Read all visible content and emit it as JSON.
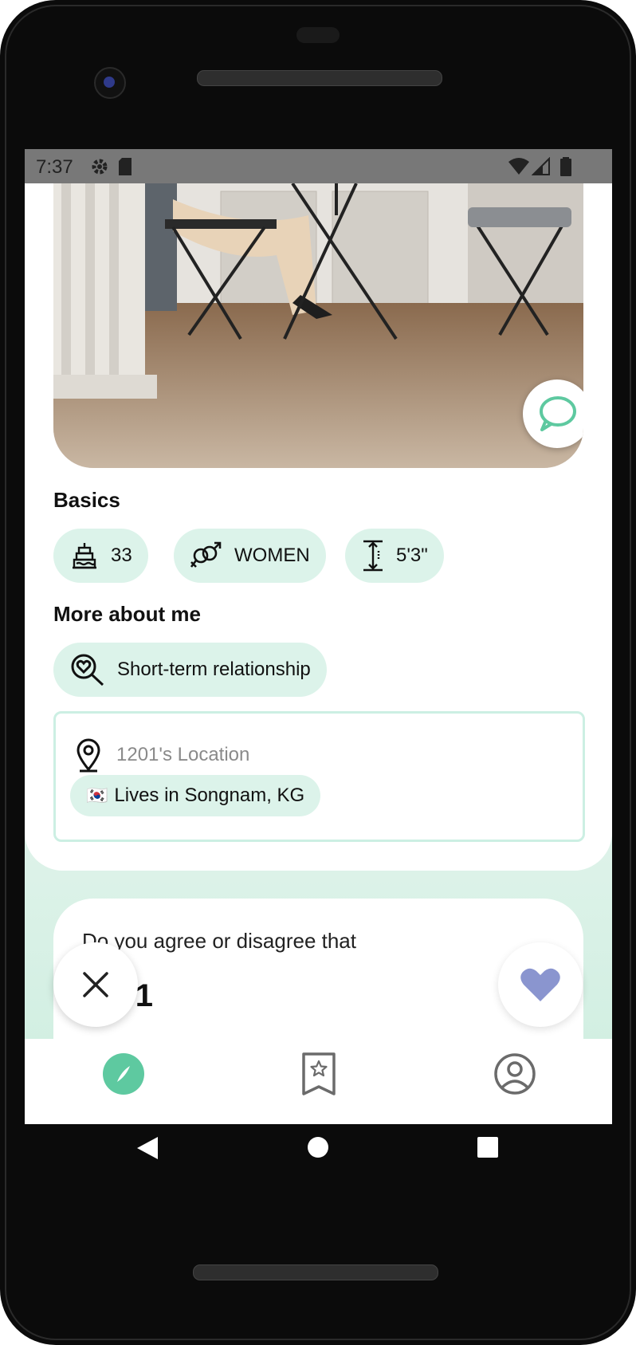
{
  "status_bar": {
    "time": "7:37"
  },
  "basics": {
    "title": "Basics",
    "chips": [
      {
        "icon": "birthday-cake-icon",
        "label": "33"
      },
      {
        "icon": "gender-symbols-icon",
        "label": "WOMEN"
      },
      {
        "icon": "height-icon",
        "label": "5'3\""
      }
    ]
  },
  "more_about": {
    "title": "More about me",
    "chip": {
      "icon": "heart-search-icon",
      "label": "Short-term relationship"
    }
  },
  "location": {
    "label": "1201's Location",
    "flag": "🇰🇷",
    "value": "Lives in Songnam,  KG"
  },
  "question": {
    "text": "Do you agree or disagree that",
    "number": "1201"
  },
  "bottom_nav": {
    "items": [
      {
        "icon": "compass-icon",
        "active": true
      },
      {
        "icon": "bookmark-star-icon",
        "active": false
      },
      {
        "icon": "profile-icon",
        "active": false
      }
    ]
  },
  "colors": {
    "accent": "#5ec9a0",
    "chip_bg": "#dcf3ea",
    "heart": "#8a95cf"
  }
}
